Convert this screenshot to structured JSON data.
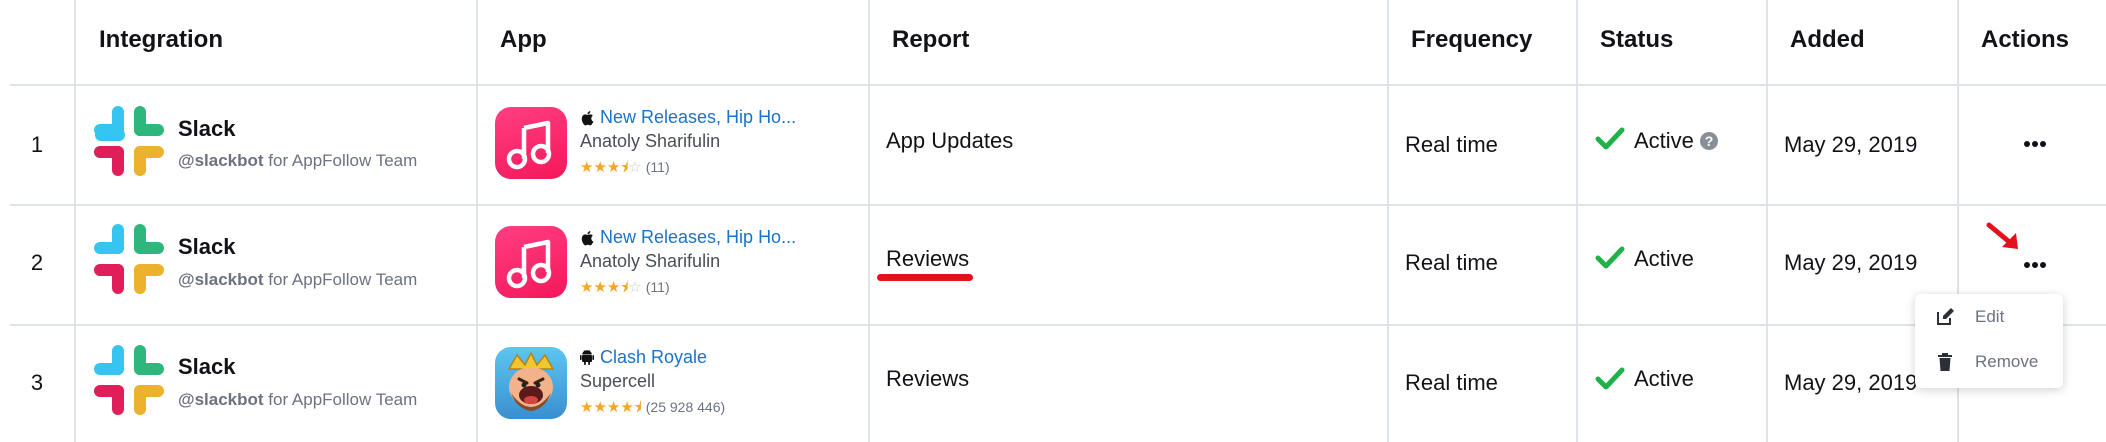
{
  "columns": {
    "integration": "Integration",
    "app": "App",
    "report": "Report",
    "frequency": "Frequency",
    "status": "Status",
    "added": "Added",
    "actions": "Actions"
  },
  "rows": [
    {
      "number": "1",
      "integration": {
        "name": "Slack",
        "handle": "@slackbot",
        "suffix": " for AppFollow Team"
      },
      "app": {
        "name": "New Releases, Hip Ho...",
        "developer": "Anatoly Sharifulin",
        "platform": "apple-icon",
        "rating": 3.5,
        "rating_count": "(11)"
      },
      "report": "App Updates",
      "frequency": "Real time",
      "status": "Active",
      "added": "May 29, 2019"
    },
    {
      "number": "2",
      "integration": {
        "name": "Slack",
        "handle": "@slackbot",
        "suffix": " for AppFollow Team"
      },
      "app": {
        "name": "New Releases, Hip Ho...",
        "developer": "Anatoly Sharifulin",
        "platform": "apple-icon",
        "rating": 3.5,
        "rating_count": "(11)"
      },
      "report": "Reviews",
      "frequency": "Real time",
      "status": "Active",
      "added": "May 29, 2019"
    },
    {
      "number": "3",
      "integration": {
        "name": "Slack",
        "handle": "@slackbot",
        "suffix": " for AppFollow Team"
      },
      "app": {
        "name": "Clash Royale",
        "developer": "Supercell",
        "platform": "android-icon",
        "rating": 4.5,
        "rating_count": "(25 928 446)"
      },
      "report": "Reviews",
      "frequency": "Real time",
      "status": "Active",
      "added": "May 29, 2019"
    }
  ],
  "actions_menu": {
    "edit": "Edit",
    "remove": "Remove"
  },
  "colors": {
    "accent_link": "#1a73c9",
    "active_check": "#1fb24a",
    "annotation_red": "#e3121a",
    "star": "#f5a623"
  }
}
